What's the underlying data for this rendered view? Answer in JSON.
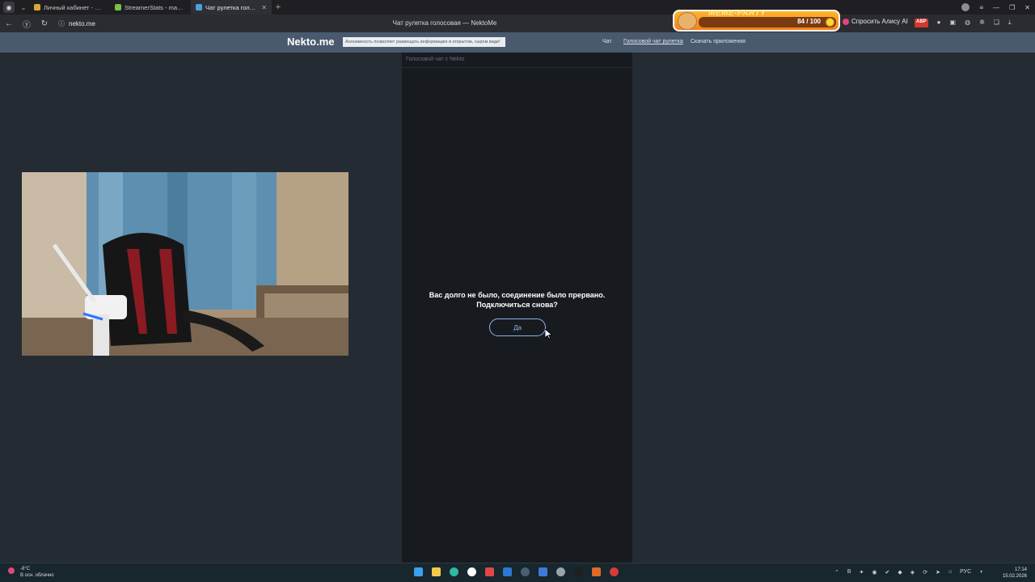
{
  "browser": {
    "tabs": [
      {
        "title": "Личный кабинет - Rampa",
        "favicon_color": "#d9a83a",
        "active": false
      },
      {
        "title": "StreamerStats - masadaca",
        "favicon_color": "#79c043",
        "active": false
      },
      {
        "title": "Чат рулетка голосовая",
        "favicon_color": "#4aa3df",
        "active": true
      }
    ],
    "new_tab_icon": "plus-icon",
    "url": "nekto.me",
    "page_title": "Чат рулетка голосовая — NektoMe",
    "meme_party": {
      "title": "MEME-PARTY",
      "count": "84 / 100"
    },
    "alice_label": "Спросить Алису AI",
    "abp_label": "ABP"
  },
  "site": {
    "logo": "Nekto.me",
    "anon_text": "Анонимность позволяет размещать информацию в открытом, сыром виде!",
    "nav": [
      "Чат",
      "Голосовой чат рулетка",
      "Скачать приложения"
    ]
  },
  "chat": {
    "header": "Голосовой чат с Nekto",
    "message_line1": "Вас долго не было, соединение было прервано.",
    "message_line2": "Подключиться снова?",
    "yes_label": "Да"
  },
  "taskbar": {
    "temp": "-8°C",
    "weather": "В осн. облачно",
    "lang": "РУС",
    "time": "17:14",
    "date": "15.02.2026"
  },
  "colors": {
    "header_bg": "#4a5a6e",
    "page_bg": "#242b33",
    "chat_bg": "#171b20",
    "button_accent": "#8db4e6"
  }
}
